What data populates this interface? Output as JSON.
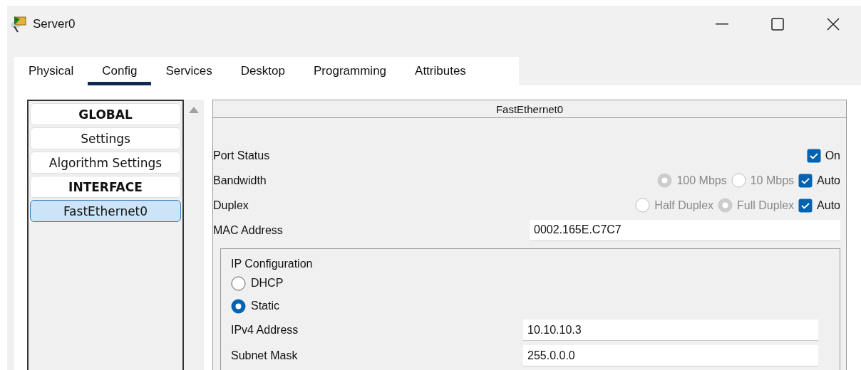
{
  "window": {
    "title": "Server0"
  },
  "tabs": [
    {
      "label": "Physical",
      "selected": false
    },
    {
      "label": "Config",
      "selected": true
    },
    {
      "label": "Services",
      "selected": false
    },
    {
      "label": "Desktop",
      "selected": false
    },
    {
      "label": "Programming",
      "selected": false
    },
    {
      "label": "Attributes",
      "selected": false
    }
  ],
  "sidebar": {
    "items": [
      {
        "label": "GLOBAL",
        "kind": "heading",
        "selected": false
      },
      {
        "label": "Settings",
        "kind": "item",
        "selected": false
      },
      {
        "label": "Algorithm Settings",
        "kind": "item",
        "selected": false
      },
      {
        "label": "INTERFACE",
        "kind": "heading",
        "selected": false
      },
      {
        "label": "FastEthernet0",
        "kind": "item",
        "selected": true
      }
    ]
  },
  "panel": {
    "title": "FastEthernet0",
    "rows": [
      {
        "label": "Port Status",
        "kind": "toggle",
        "checkbox": {
          "label": "On",
          "checked": true
        }
      },
      {
        "label": "Bandwidth",
        "kind": "choice",
        "options": [
          {
            "label": "100 Mbps",
            "selected": true,
            "disabled": true
          },
          {
            "label": "10 Mbps",
            "selected": false,
            "disabled": true
          }
        ],
        "checkbox": {
          "label": "Auto",
          "checked": true
        }
      },
      {
        "label": "Duplex",
        "kind": "choice",
        "options": [
          {
            "label": "Half Duplex",
            "selected": false,
            "disabled": true
          },
          {
            "label": "Full Duplex",
            "selected": true,
            "disabled": true
          }
        ],
        "checkbox": {
          "label": "Auto",
          "checked": true
        }
      },
      {
        "label": "MAC Address",
        "kind": "field",
        "value": "0002.165E.C7C7"
      }
    ],
    "ip_configuration": {
      "title": "IP Configuration",
      "modes": [
        {
          "label": "DHCP",
          "selected": false
        },
        {
          "label": "Static",
          "selected": true
        }
      ],
      "fields": [
        {
          "label": "IPv4 Address",
          "value": "10.10.10.3"
        },
        {
          "label": "Subnet Mask",
          "value": "255.0.0.0"
        }
      ]
    }
  }
}
